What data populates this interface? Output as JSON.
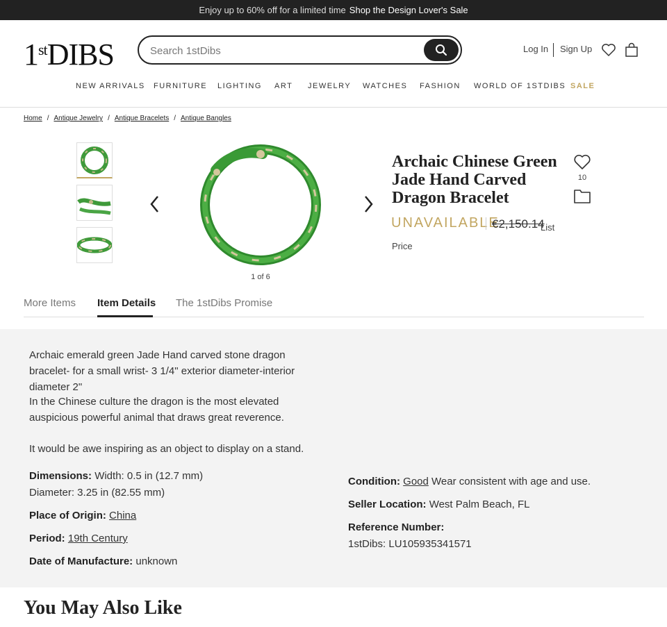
{
  "promo": {
    "text": "Enjoy up to 60% off for a limited time",
    "link": "Shop the Design Lover's Sale"
  },
  "header": {
    "logo": "1stDIBS",
    "search_placeholder": "Search 1stDibs",
    "log_in": "Log In",
    "sign_up": "Sign Up"
  },
  "nav": [
    "NEW ARRIVALS",
    "FURNITURE",
    "LIGHTING",
    "ART",
    "JEWELRY",
    "WATCHES",
    "FASHION",
    "WORLD OF 1STDIBS",
    "SALE"
  ],
  "breadcrumb": [
    "Home",
    "Antique Jewelry",
    "Antique Bracelets",
    "Antique Bangles"
  ],
  "gallery": {
    "counter": "1 of 6"
  },
  "product": {
    "title": "Archaic Chinese Green Jade Hand Carved Dragon Bracelet",
    "likes": "10",
    "status": "UNAVAILABLE",
    "price": "€2,150.14",
    "price_label": "List Price"
  },
  "tabs": [
    "More Items",
    "Item Details",
    "The 1stDibs Promise"
  ],
  "details": {
    "paragraphs": [
      "Archaic emerald green Jade Hand carved stone dragon bracelet- for a small wrist- 3 1/4\" exterior diameter-interior diameter 2\"",
      "In the Chinese culture the dragon is the most elevated auspicious powerful animal that draws great reverence.",
      "It would be awe inspiring as an object to display on a stand."
    ],
    "dimensions_label": "Dimensions:",
    "dimensions_value": "Width: 0.5 in (12.7 mm)",
    "diameter_value": "Diameter: 3.25 in (82.55 mm)",
    "origin_label": "Place of Origin:",
    "origin_value": "China",
    "period_label": "Period:",
    "period_value": "19th Century",
    "date_label": "Date of Manufacture:",
    "date_value": "unknown",
    "condition_label": "Condition:",
    "condition_value": "Good",
    "condition_note": "Wear consistent with age and use.",
    "location_label": "Seller Location:",
    "location_value": "West Palm Beach, FL",
    "reference_label": "Reference Number:",
    "reference_value": "1stDibs: LU105935341571"
  },
  "recommend_title": "You May Also Like"
}
